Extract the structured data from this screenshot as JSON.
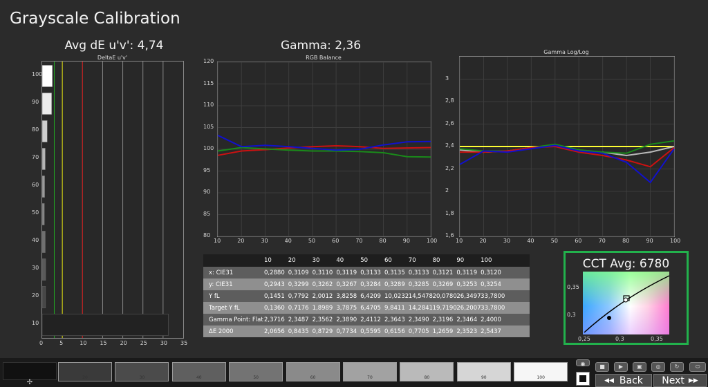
{
  "page": {
    "title": "Grayscale Calibration"
  },
  "deltae_chart": {
    "header": "Avg dE u'v': 4,74",
    "subtitle": "DeltaE u'v'",
    "x_ticks": [
      "0",
      "5",
      "10",
      "15",
      "20",
      "25",
      "30",
      "35"
    ],
    "y_ticks": [
      "100",
      "90",
      "80",
      "70",
      "60",
      "50",
      "40",
      "30",
      "20",
      "10"
    ]
  },
  "rgb_chart": {
    "header": "Gamma: 2,36",
    "subtitle": "RGB Balance",
    "x_ticks": [
      "10",
      "20",
      "30",
      "40",
      "50",
      "60",
      "70",
      "80",
      "90",
      "100"
    ],
    "y_ticks": [
      "120",
      "115",
      "110",
      "105",
      "100",
      "95",
      "90",
      "85",
      "80"
    ]
  },
  "gamma_chart": {
    "subtitle": "Gamma Log/Log",
    "x_ticks": [
      "10",
      "20",
      "30",
      "40",
      "50",
      "60",
      "70",
      "80",
      "90",
      "100"
    ],
    "y_ticks": [
      "3",
      "2,8",
      "2,6",
      "2,4",
      "2,2",
      "2",
      "1,8",
      "1,6"
    ]
  },
  "chart_data": [
    {
      "type": "bar",
      "subtitle": "DeltaE u'v'",
      "orientation": "horizontal",
      "categories": [
        "100",
        "90",
        "80",
        "70",
        "60",
        "50",
        "40",
        "30",
        "20",
        "10"
      ],
      "values": [
        2.54,
        2.35,
        1.27,
        0.77,
        0.62,
        0.56,
        0.77,
        0.87,
        0.84,
        31.3
      ],
      "colors": [
        "#ffffff",
        "#ececec",
        "#cfcfcf",
        "#b5b5b5",
        "#9a9a9a",
        "#858585",
        "#707070",
        "#5a5a5a",
        "#474747",
        "#222222"
      ],
      "reference_lines": [
        {
          "x": 3,
          "color": "#22aa22"
        },
        {
          "x": 5,
          "color": "#d8d800"
        },
        {
          "x": 10,
          "color": "#cc1111"
        }
      ],
      "xlim": [
        0,
        35
      ]
    },
    {
      "type": "line",
      "title": "RGB Balance",
      "x": [
        10,
        20,
        30,
        40,
        50,
        60,
        70,
        80,
        90,
        100
      ],
      "ylim": [
        80,
        120
      ],
      "series": [
        {
          "color": "#cc1111",
          "values": [
            98.6,
            99.6,
            99.9,
            100.3,
            100.6,
            100.8,
            100.6,
            100.2,
            100.3,
            100.4
          ]
        },
        {
          "color": "#1a8a1a",
          "values": [
            99.6,
            100.4,
            100.1,
            99.8,
            99.6,
            99.6,
            99.5,
            99.2,
            98.3,
            98.2
          ]
        },
        {
          "color": "#1111cc",
          "values": [
            103.2,
            100.6,
            100.9,
            100.6,
            100.2,
            99.8,
            100.0,
            101.0,
            101.7,
            101.8
          ]
        }
      ]
    },
    {
      "type": "line",
      "title": "Gamma Log/Log",
      "x": [
        10,
        20,
        30,
        40,
        50,
        60,
        70,
        80,
        90,
        100
      ],
      "ylim": [
        1.6,
        3.2
      ],
      "series": [
        {
          "color": "#ffff33",
          "values": [
            2.4,
            2.4,
            2.4,
            2.4,
            2.4,
            2.4,
            2.4,
            2.4,
            2.4,
            2.4
          ]
        },
        {
          "color": "#b9b9b9",
          "values": [
            2.37,
            2.35,
            2.36,
            2.39,
            2.41,
            2.36,
            2.35,
            2.32,
            2.35,
            2.4
          ]
        },
        {
          "color": "#1a8a1a",
          "values": [
            2.38,
            2.36,
            2.36,
            2.39,
            2.42,
            2.37,
            2.35,
            2.34,
            2.42,
            2.45
          ]
        },
        {
          "color": "#cc1111",
          "values": [
            2.35,
            2.35,
            2.36,
            2.39,
            2.4,
            2.35,
            2.32,
            2.28,
            2.22,
            2.39
          ]
        },
        {
          "color": "#1111cc",
          "values": [
            2.24,
            2.36,
            2.35,
            2.38,
            2.41,
            2.36,
            2.34,
            2.26,
            2.08,
            2.38
          ]
        }
      ]
    }
  ],
  "table": {
    "columns": [
      "10",
      "20",
      "30",
      "40",
      "50",
      "60",
      "70",
      "80",
      "90",
      "100"
    ],
    "rows": [
      {
        "label": "x: CIE31",
        "values": [
          "0,2880",
          "0,3109",
          "0,3110",
          "0,3119",
          "0,3133",
          "0,3135",
          "0,3133",
          "0,3121",
          "0,3119",
          "0,3120"
        ]
      },
      {
        "label": "y: CIE31",
        "values": [
          "0,2943",
          "0,3299",
          "0,3262",
          "0,3267",
          "0,3284",
          "0,3289",
          "0,3285",
          "0,3269",
          "0,3253",
          "0,3254"
        ]
      },
      {
        "label": "Y fL",
        "values": [
          "0,1451",
          "0,7792",
          "2,0012",
          "3,8258",
          "6,4209",
          "10,0232",
          "14,5478",
          "20,0780",
          "26,3497",
          "33,7800"
        ]
      },
      {
        "label": "Target Y fL",
        "values": [
          "0,1360",
          "0,7176",
          "1,8989",
          "3,7875",
          "6,4705",
          "9,8411",
          "14,2841",
          "19,7190",
          "26,2007",
          "33,7800"
        ]
      },
      {
        "label": "Gamma Point: Flat",
        "values": [
          "2,3716",
          "2,3487",
          "2,3562",
          "2,3890",
          "2,4112",
          "2,3643",
          "2,3490",
          "2,3196",
          "2,3464",
          "2,4000"
        ]
      },
      {
        "label": "ΔE 2000",
        "values": [
          "2,0656",
          "0,8435",
          "0,8729",
          "0,7734",
          "0,5595",
          "0,6156",
          "0,7705",
          "1,2659",
          "2,3523",
          "2,5437"
        ]
      }
    ]
  },
  "cct": {
    "header": "CCT Avg: 6780",
    "x_ticks": [
      "0,25",
      "0,3",
      "0,35"
    ],
    "y_ticks": [
      "0,35",
      "0,3"
    ]
  },
  "bottom": {
    "swatches": [
      {
        "label": "20",
        "color": "#3a3a3a"
      },
      {
        "label": "30",
        "color": "#4b4b4b"
      },
      {
        "label": "40",
        "color": "#5f5f5f"
      },
      {
        "label": "50",
        "color": "#737373"
      },
      {
        "label": "60",
        "color": "#8a8a8a"
      },
      {
        "label": "70",
        "color": "#a2a2a2"
      },
      {
        "label": "80",
        "color": "#bababa"
      },
      {
        "label": "90",
        "color": "#d6d6d6"
      },
      {
        "label": "100",
        "color": "#f6f6f6"
      }
    ],
    "back_label": "Back",
    "next_label": "Next"
  }
}
